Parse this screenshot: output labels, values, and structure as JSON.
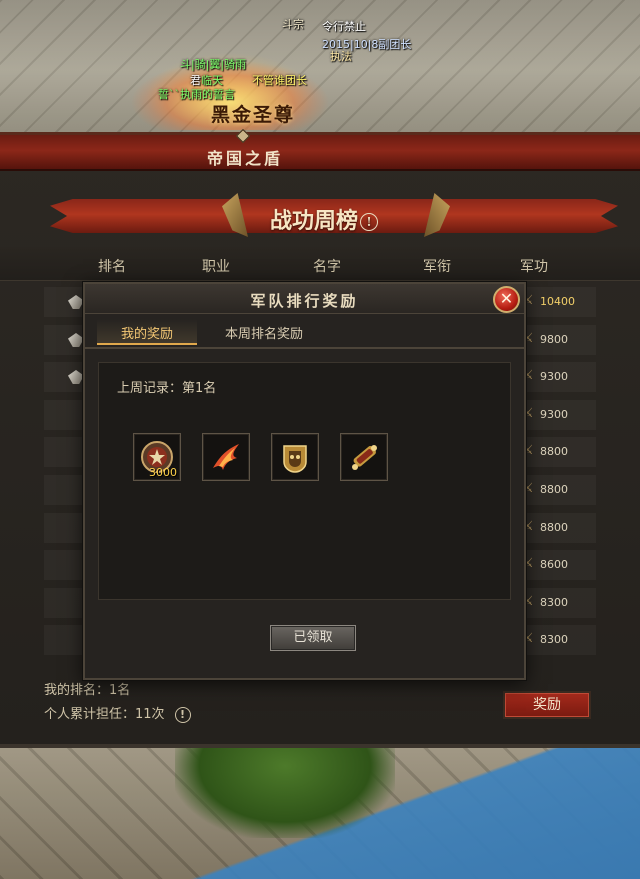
{
  "scene": {
    "overhead_labels": {
      "guild_tag": "斗宗",
      "status": "令行禁止",
      "date_role": "2015|10|8副团长",
      "sub_tag": "执法",
      "name_green": "斗|骑|翼|骑雨",
      "name_white_tag": "君",
      "name_mid": "临天",
      "name_yellow": "不管谁团长",
      "name_bottom": "誓``执雨的誓言",
      "title_badge": "黑金圣尊"
    }
  },
  "panel": {
    "header_title": "帝国之盾",
    "ribbon_title": "战功周榜",
    "info_icon": "!",
    "columns": [
      "排名",
      "职业",
      "名字",
      "军衔",
      "军功"
    ],
    "merit_values": [
      "10400",
      "9800",
      "9300",
      "9300",
      "8800",
      "8800",
      "8800",
      "8600",
      "8300",
      "8300"
    ],
    "my_rank": "我的排名：1名",
    "total_terms": "个人累计担任：11次",
    "reward_button": "奖励"
  },
  "modal": {
    "title": "军队排行奖励",
    "close": "✕",
    "tabs": [
      "我的奖励",
      "本周排名奖励"
    ],
    "active_tab": "我的奖励",
    "last_week": "上周记录：第1名",
    "items": [
      {
        "icon": "merit-medal-icon",
        "quantity": "3000"
      },
      {
        "icon": "flame-wing-icon",
        "quantity": ""
      },
      {
        "icon": "golden-mask-icon",
        "quantity": ""
      },
      {
        "icon": "golden-scroll-icon",
        "quantity": ""
      }
    ],
    "claimed_button": "已领取"
  },
  "colors": {
    "accent_gold": "#f3c774",
    "header_red": "#8c2719",
    "quantity_yellow": "#ffd24a"
  }
}
